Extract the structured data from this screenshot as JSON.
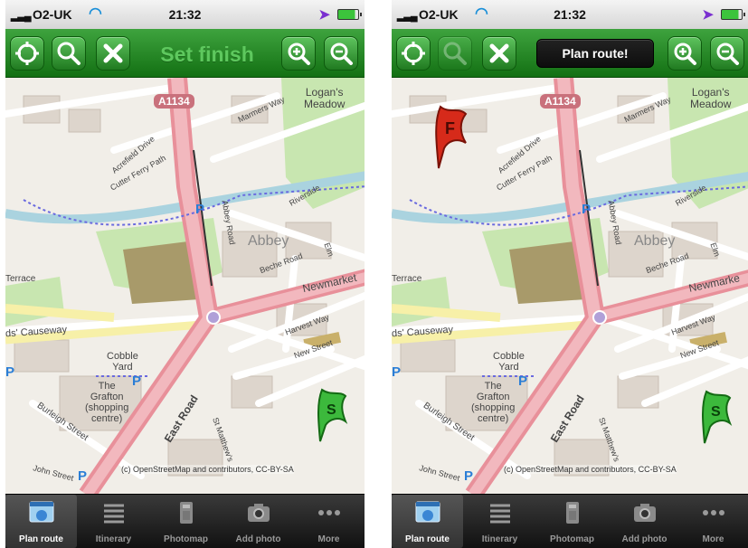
{
  "screens": [
    {
      "status": {
        "carrier": "O2-UK",
        "time": "21:32"
      },
      "toolbar": {
        "title": "Set finish"
      },
      "map": {
        "labels": {
          "road_a1134": "A1134",
          "logans_meadow": "Logan's\nMeadow",
          "abbey": "Abbey",
          "newmarket": "Newmarket",
          "cobble_yard": "Cobble\nYard",
          "grafton": "The\nGrafton\n(shopping\ncentre)",
          "east_road": "East Road",
          "causeway": "ds' Causeway",
          "terrace": "Terrace",
          "burleigh": "Burleigh Street",
          "john_street": "John Street",
          "abbey_road": "Abbey Road",
          "cutter_ferry": "Cutter Ferry Path",
          "acrefield": "Acrefield Drive",
          "beche_road": "Beche Road",
          "riverside": "Riverside",
          "harvest_way": "Harvest Way",
          "new_street": "New Street",
          "st_matthews": "St Matthew's",
          "marmers_way": "Marmers Way",
          "elm": "Elm"
        },
        "attribution": "(c) OpenStreetMap and contributors, CC-BY-SA",
        "markers": [
          {
            "letter": "S",
            "color": "#3cb93c"
          }
        ]
      },
      "tabs": [
        {
          "label": "Plan route",
          "icon": "map-globe-icon",
          "selected": true
        },
        {
          "label": "Itinerary",
          "icon": "list-icon",
          "selected": false
        },
        {
          "label": "Photomap",
          "icon": "photomap-icon",
          "selected": false
        },
        {
          "label": "Add photo",
          "icon": "camera-icon",
          "selected": false
        },
        {
          "label": "More",
          "icon": "more-dots-icon",
          "selected": false
        }
      ]
    },
    {
      "status": {
        "carrier": "O2-UK",
        "time": "21:32"
      },
      "toolbar": {
        "button": "Plan route!"
      },
      "map": {
        "labels": {
          "road_a1134": "A1134",
          "logans_meadow": "Logan's\nMeadow",
          "abbey": "Abbey",
          "newmarket": "Newmarke",
          "cobble_yard": "Cobble\nYard",
          "grafton": "The\nGrafton\n(shopping\ncentre)",
          "east_road": "East Road",
          "causeway": "ds' Causeway",
          "terrace": "Terrace",
          "burleigh": "Burleigh Street",
          "john_street": "John Street",
          "abbey_road": "Abbey Road",
          "cutter_ferry": "Cutter Ferry Path",
          "acrefield": "Acrefield Drive",
          "beche_road": "Beche Road",
          "riverside": "Riverside",
          "harvest_way": "Harvest Way",
          "new_street": "New Street",
          "st_matthews": "St Matthew's",
          "marmers_way": "Marmers Way",
          "elm": "Elm"
        },
        "attribution": "(c) OpenStreetMap and contributors, CC-BY-SA",
        "markers": [
          {
            "letter": "F",
            "color": "#d62a1a"
          },
          {
            "letter": "S",
            "color": "#3cb93c"
          }
        ]
      },
      "tabs": [
        {
          "label": "Plan route",
          "icon": "map-globe-icon",
          "selected": true
        },
        {
          "label": "Itinerary",
          "icon": "list-icon",
          "selected": false
        },
        {
          "label": "Photomap",
          "icon": "photomap-icon",
          "selected": false
        },
        {
          "label": "Add photo",
          "icon": "camera-icon",
          "selected": false
        },
        {
          "label": "More",
          "icon": "more-dots-icon",
          "selected": false
        }
      ]
    }
  ]
}
